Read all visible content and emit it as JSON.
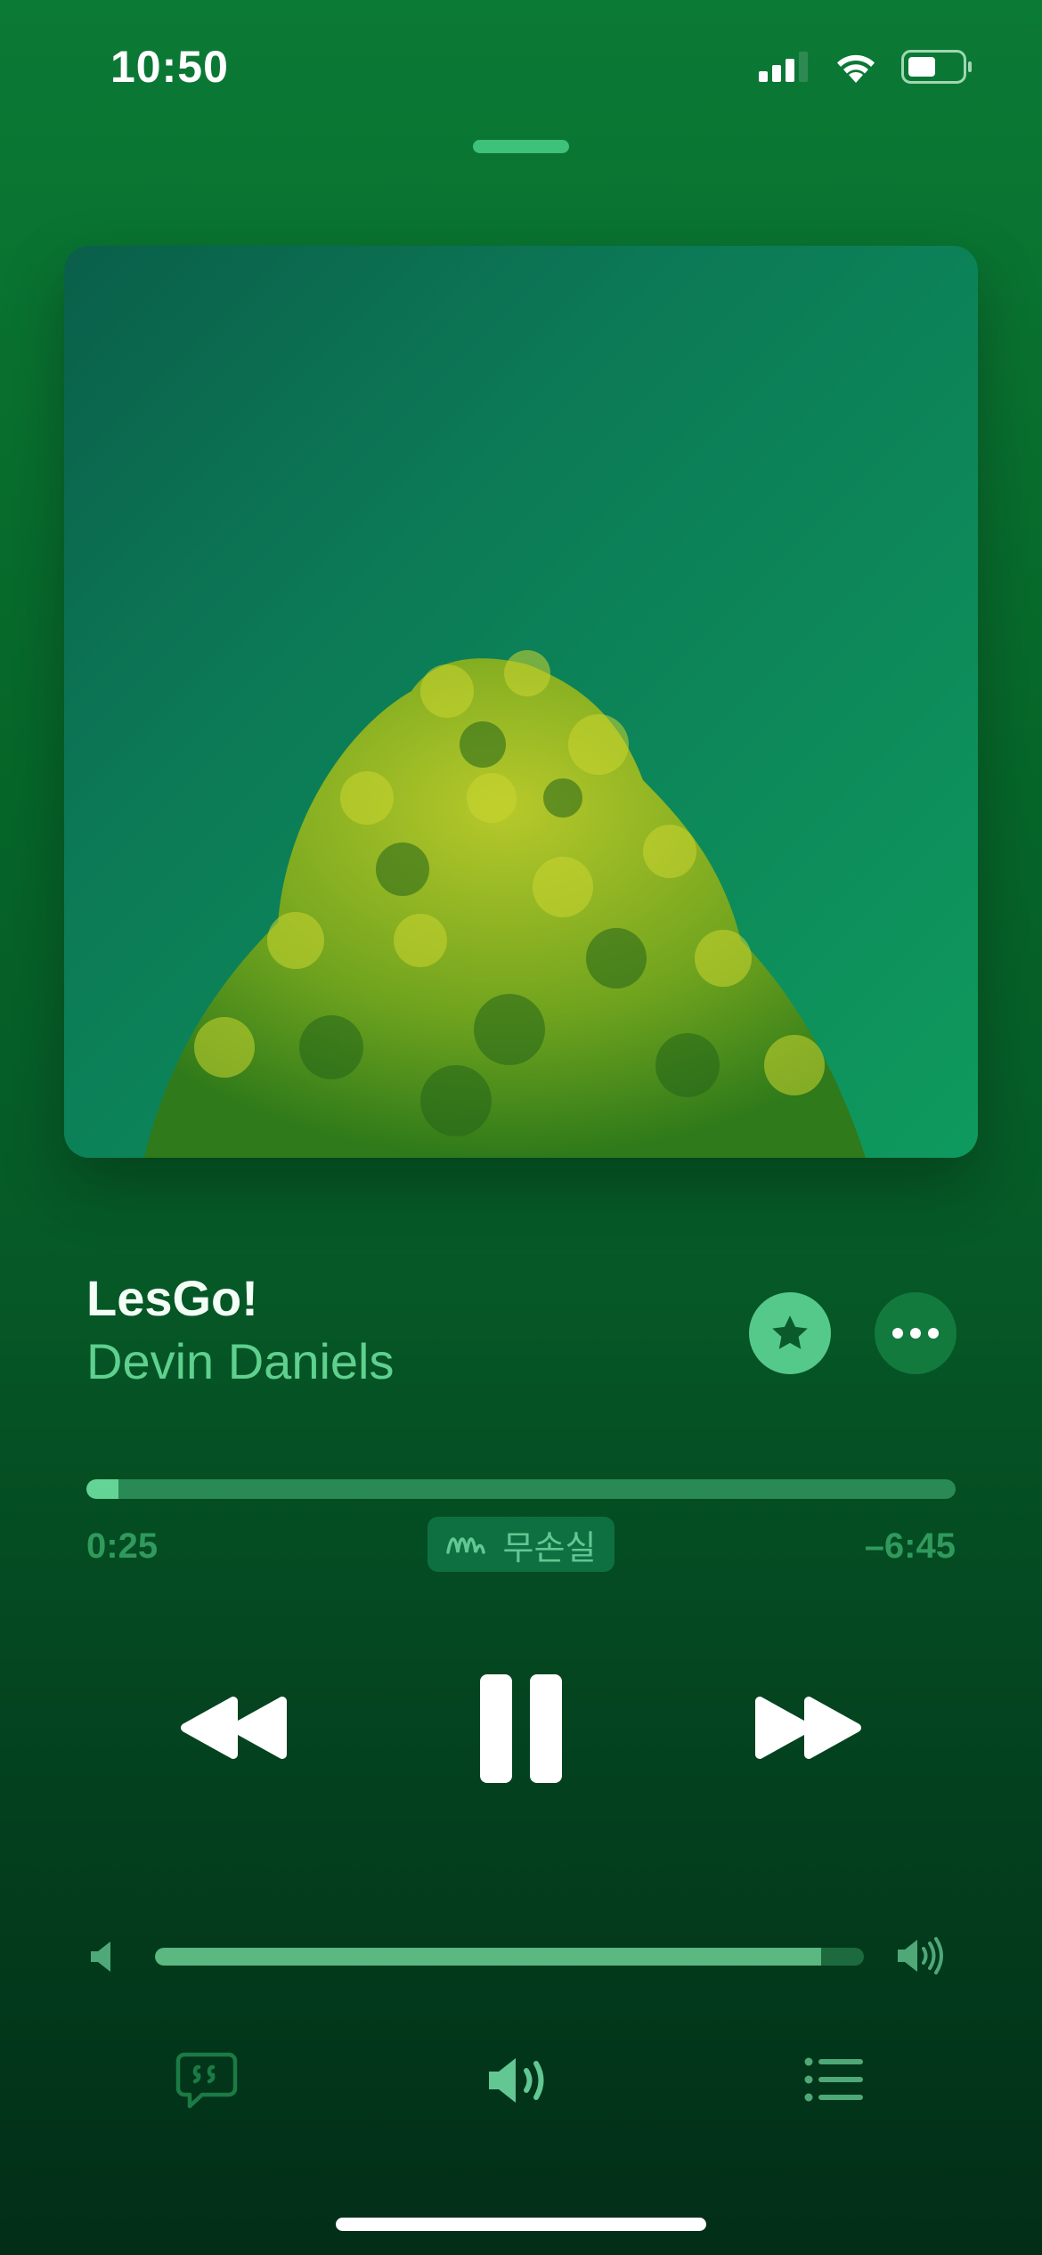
{
  "status_bar": {
    "time": "10:50",
    "icons": [
      "cellular-signal-icon",
      "wifi-icon",
      "battery-icon"
    ]
  },
  "now_playing": {
    "title": "LesGo!",
    "artist": "Devin Daniels",
    "favorite_icon": "star-icon",
    "more_icon": "ellipsis-icon"
  },
  "playback": {
    "elapsed": "0:25",
    "remaining": "–6:45",
    "progress_fraction": 0.037,
    "audio_quality_label": "무손실",
    "audio_quality_icon": "lossless-waveform-icon"
  },
  "controls": {
    "rewind_icon": "rewind-icon",
    "pause_icon": "pause-icon",
    "forward_icon": "fast-forward-icon"
  },
  "volume": {
    "level_fraction": 0.94,
    "low_icon": "speaker-low-icon",
    "high_icon": "speaker-high-icon"
  },
  "bottom_bar": {
    "items": [
      "lyrics-icon",
      "airplay-icon",
      "queue-list-icon"
    ]
  },
  "colors": {
    "background_top": "#0b7a35",
    "background_bottom": "#022e17",
    "accent": "#5fd08e",
    "title": "#f3fff6"
  }
}
